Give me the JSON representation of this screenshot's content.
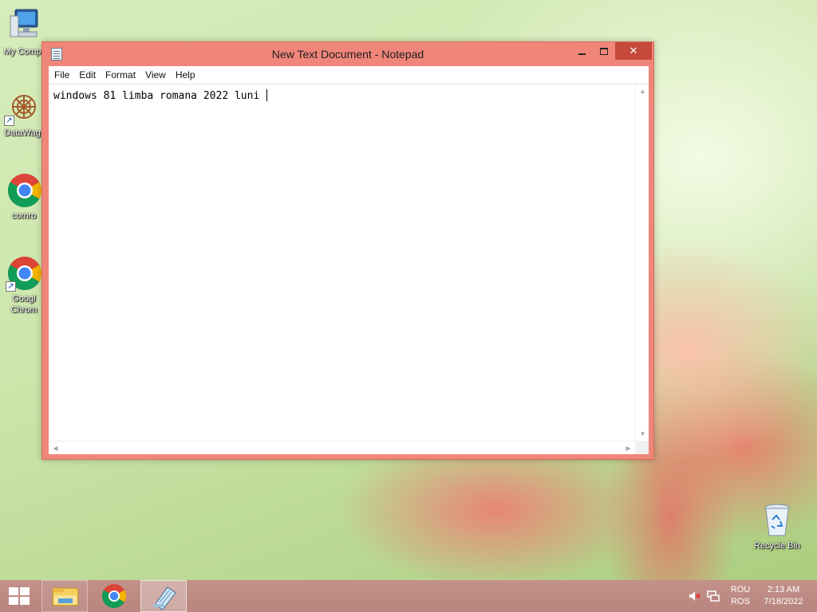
{
  "desktop": {
    "icons": [
      {
        "label": "My Comp",
        "icon": "computer-icon"
      },
      {
        "label": "DataWag",
        "icon": "datawag-icon"
      },
      {
        "label": "comro",
        "icon": "chrome-icon"
      },
      {
        "label": "Googl\nChrom",
        "icon": "chrome-icon"
      },
      {
        "label": "Recycle Bin",
        "icon": "recycle-bin-icon"
      }
    ]
  },
  "window": {
    "title": "New Text Document - Notepad",
    "menu": [
      "File",
      "Edit",
      "Format",
      "View",
      "Help"
    ],
    "content": "windows 81 limba romana 2022 luni ",
    "close_label": "✕",
    "accent_color": "#f0867a"
  },
  "taskbar": {
    "apps": [
      {
        "name": "File Explorer",
        "icon": "file-explorer-icon"
      },
      {
        "name": "Google Chrome",
        "icon": "chrome-icon"
      },
      {
        "name": "Notepad",
        "icon": "notepad-icon",
        "active": true
      }
    ],
    "tray": {
      "lang_top": "ROU",
      "lang_bottom": "ROS",
      "time": "2:13 AM",
      "date": "7/18/2022"
    }
  }
}
